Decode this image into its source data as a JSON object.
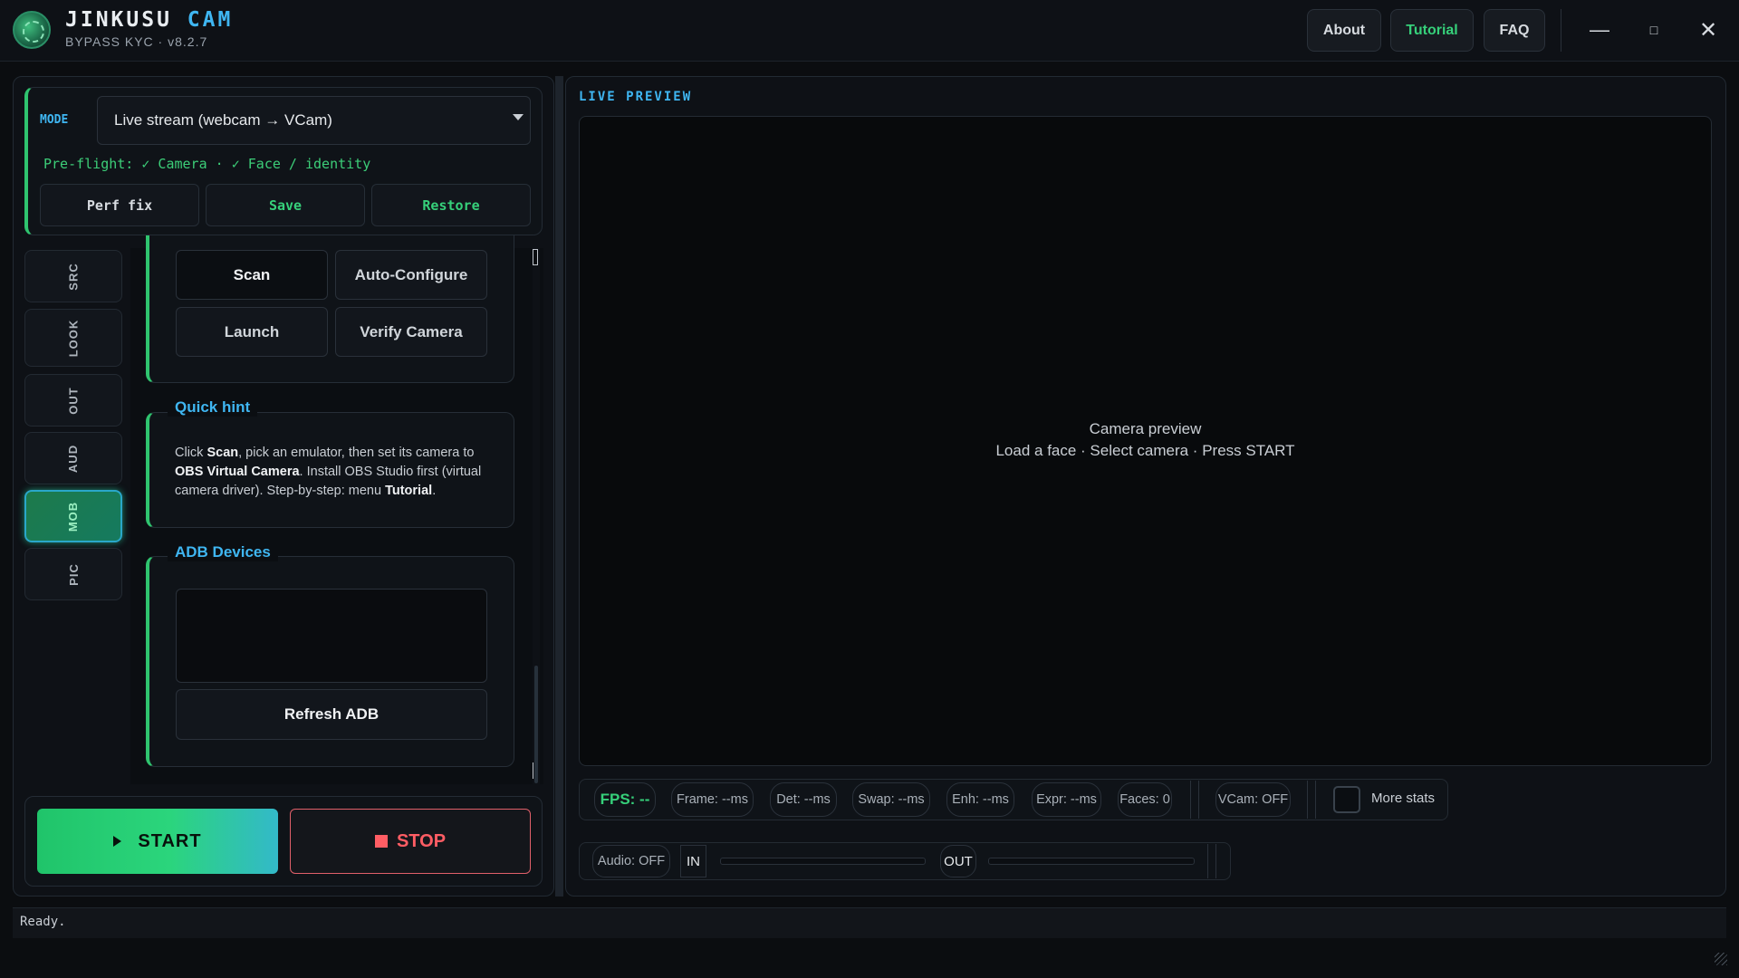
{
  "header": {
    "app_name": "JINKUSU",
    "app_name_accent": "CAM",
    "subtitle": "BYPASS KYC · v8.2.7",
    "buttons": {
      "about": "About",
      "tutorial": "Tutorial",
      "faq": "FAQ"
    },
    "window_controls": {
      "minimize": "—",
      "maximize": "□",
      "close": "✕"
    }
  },
  "mode": {
    "label": "MODE",
    "selected": "Live stream (webcam → VCam)",
    "preflight": "Pre-flight: ✓ Camera · ✓ Face / identity",
    "buttons": {
      "perf_fix": "Perf fix",
      "save": "Save",
      "restore": "Restore"
    }
  },
  "side_tabs": [
    {
      "label": "SRC",
      "active": false
    },
    {
      "label": "LOOK",
      "active": false
    },
    {
      "label": "OUT",
      "active": false
    },
    {
      "label": "AUD",
      "active": false
    },
    {
      "label": "MOB",
      "active": true
    },
    {
      "label": "PIC",
      "active": false
    }
  ],
  "mob": {
    "buttons": {
      "scan": "Scan",
      "auto_configure": "Auto-Configure",
      "launch": "Launch",
      "verify_camera": "Verify Camera"
    },
    "hint": {
      "title": "Quick hint",
      "t1": "Click ",
      "b1": "Scan",
      "t2": ", pick an emulator, then set its camera to ",
      "b2": "OBS Virtual Camera",
      "t3": ". Install OBS Studio first (virtual camera driver). Step-by-step: menu ",
      "b3": "Tutorial",
      "t4": "."
    },
    "adb": {
      "title": "ADB Devices",
      "refresh": "Refresh ADB"
    }
  },
  "controls": {
    "start": "START",
    "stop": "STOP"
  },
  "preview": {
    "title": "LIVE PREVIEW",
    "line1": "Camera preview",
    "line2": "Load a face  ·  Select camera  ·  Press START"
  },
  "stats": {
    "fps": "FPS: --",
    "frame": "Frame: --ms",
    "det": "Det: --ms",
    "swap": "Swap: --ms",
    "enh": "Enh: --ms",
    "expr": "Expr: --ms",
    "faces": "Faces: 0",
    "vcam": "VCam: OFF",
    "more_stats": "More stats",
    "more_stats_checked": false
  },
  "audio": {
    "state": "Audio: OFF",
    "in": "IN",
    "out": "OUT",
    "in_level": 0,
    "out_level": 0
  },
  "status": {
    "text": "Ready."
  },
  "colors": {
    "accent_blue": "#3fb6f2",
    "accent_green": "#2fc46f",
    "stop_red": "#ff5d64",
    "background": "#0b0d10"
  }
}
